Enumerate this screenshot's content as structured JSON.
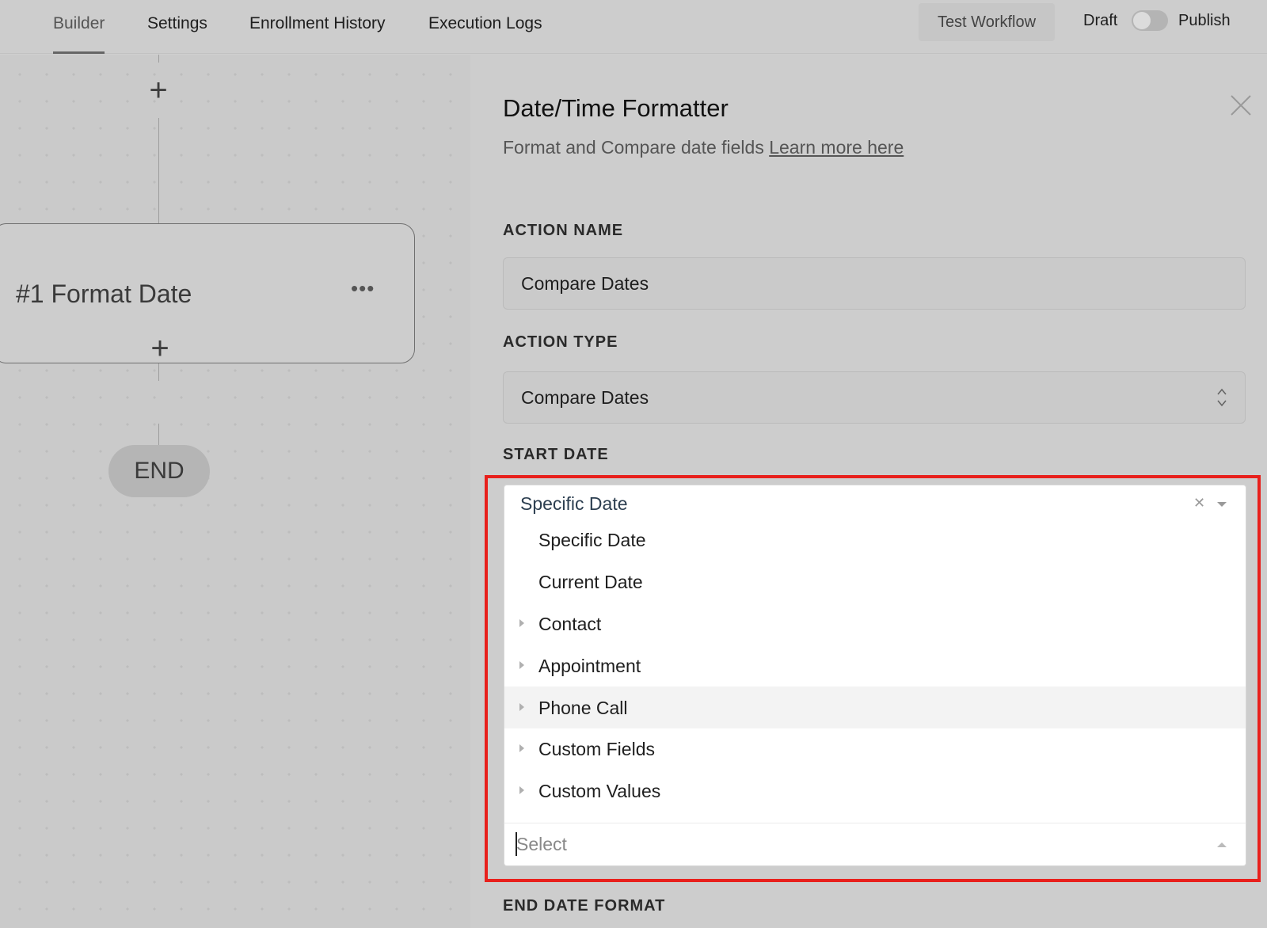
{
  "topbar": {
    "tabs": [
      {
        "label": "Builder",
        "active": true
      },
      {
        "label": "Settings"
      },
      {
        "label": "Enrollment History"
      },
      {
        "label": "Execution Logs"
      }
    ],
    "test_workflow": "Test Workflow",
    "draft": "Draft",
    "publish": "Publish",
    "publish_toggle_on": false
  },
  "canvas": {
    "node_title": "#1 Format Date",
    "node_menu": "•••",
    "end_label": "END",
    "add_icon": "plus-icon"
  },
  "panel": {
    "title": "Date/Time Formatter",
    "subtitle": "Format and Compare date fields",
    "learn_more": "Learn more here",
    "action_name_label": "ACTION NAME",
    "action_name_value": "Compare Dates",
    "action_type_label": "ACTION TYPE",
    "action_type_value": "Compare Dates",
    "start_date_label": "START DATE",
    "start_date_value": "Specific Date",
    "start_date_options": [
      {
        "label": "Specific Date",
        "has_children": false
      },
      {
        "label": "Current Date",
        "has_children": false
      },
      {
        "label": "Contact",
        "has_children": true
      },
      {
        "label": "Appointment",
        "has_children": true
      },
      {
        "label": "Phone Call",
        "has_children": true,
        "hovered": true
      },
      {
        "label": "Custom Fields",
        "has_children": true
      },
      {
        "label": "Custom Values",
        "has_children": true
      }
    ],
    "search_placeholder": "Select",
    "end_date_format_label": "END DATE FORMAT"
  },
  "colors": {
    "highlight": "#e8201c",
    "overlay": "#cdcdcd"
  }
}
